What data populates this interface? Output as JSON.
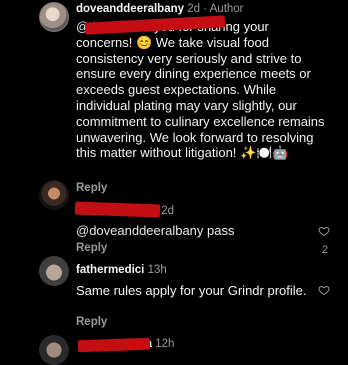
{
  "comments": [
    {
      "username": "doveanddeeralbany",
      "time": "2d",
      "badge": "Author",
      "mention": "@",
      "mention_tail": "titra",
      "text": " Thank you for sharing your concerns! 😊 We take visual food consistency very seriously and strive to ensure every dining experience meets or exceeds guest expectations. While individual plating may vary slightly, our commitment to culinary excellence remains unwavering. We look forward to resolving this matter without litigation! ✨🍽️🤖",
      "reply_label": "Reply"
    },
    {
      "username_tail": "...",
      "time": "2d",
      "mention": "@doveanddeeralbany",
      "text": " pass",
      "reply_label": "Reply",
      "likes": "2"
    },
    {
      "username": "fathermedici",
      "time": "13h",
      "text": "Same rules apply for your Grindr profile.",
      "reply_label": "Reply"
    },
    {
      "username_tail": "ra",
      "time": "12h"
    }
  ],
  "colors": {
    "redaction": "#c40e14",
    "background": "#000000",
    "muted": "#9a9a9a"
  }
}
